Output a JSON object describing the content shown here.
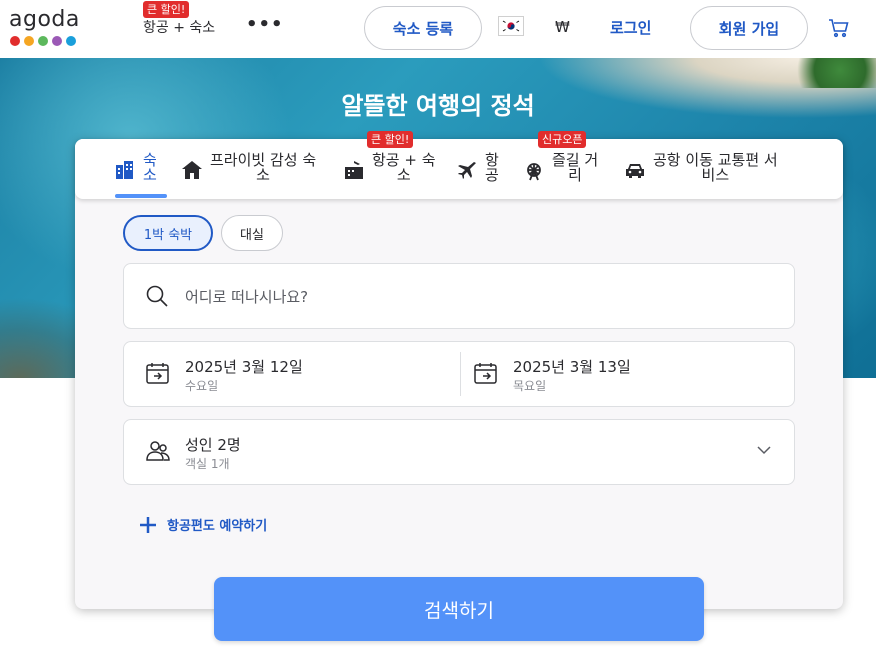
{
  "header": {
    "logo_text": "agoda",
    "logo_dot_colors": [
      "#e12d2d",
      "#f5a623",
      "#5cb85c",
      "#9b59b6",
      "#1a9fdb"
    ],
    "package_link": "항공 + 숙소",
    "package_badge": "큰 할인!",
    "more_label": "•••",
    "register_button": "숙소 등록",
    "flag_icon": "kr-flag-icon",
    "currency": "₩",
    "login": "로그인",
    "signup_button": "회원 가입",
    "cart_icon": "cart-icon"
  },
  "hero": {
    "title": "알뜰한 여행의 정석"
  },
  "tabs": [
    {
      "label": "숙\n소",
      "icon": "hotel-icon",
      "active": true
    },
    {
      "label": "프라이빗 감성 숙\n소",
      "icon": "home-icon",
      "active": false
    },
    {
      "label": "항공 + 숙\n소",
      "icon": "package-icon",
      "active": false,
      "badge": "큰 할인!"
    },
    {
      "label": "항\n공",
      "icon": "plane-icon",
      "active": false
    },
    {
      "label": "즐길 거\n리",
      "icon": "ferris-wheel-icon",
      "active": false,
      "badge": "신규오픈"
    },
    {
      "label": "공항 이동 교통편 서\n비스",
      "icon": "car-icon",
      "active": false
    }
  ],
  "stay_type": {
    "options": [
      "1박 숙박",
      "대실"
    ],
    "selected": "1박 숙박"
  },
  "search": {
    "placeholder": "어디로 떠나시나요?"
  },
  "dates": {
    "checkin": {
      "date": "2025년 3월 12일",
      "day": "수요일"
    },
    "checkout": {
      "date": "2025년 3월 13일",
      "day": "목요일"
    }
  },
  "guests": {
    "main": "성인 2명",
    "sub": "객실 1개"
  },
  "add_flight": "항공편도 예약하기",
  "search_button": "검색하기",
  "colors": {
    "accent": "#2059c5",
    "search_button": "#5392f9",
    "badge": "#e12d2d"
  }
}
